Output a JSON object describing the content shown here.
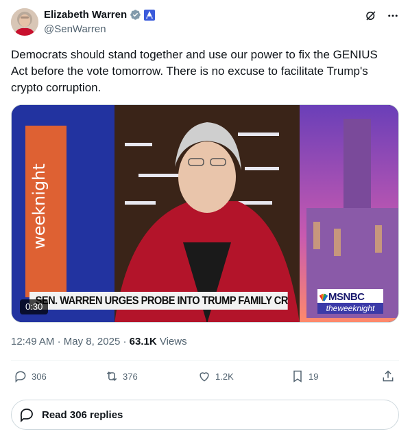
{
  "author": {
    "name": "Elizabeth Warren",
    "handle": "@SenWarren"
  },
  "tweet": {
    "text": "Democrats should stand together and use our power to fix the GENIUS Act before the vote tomorrow. There is no excuse to facilitate Trump's crypto corruption."
  },
  "media": {
    "chyron": "SEN. WARREN URGES PROBE INTO TRUMP FAMILY CRYPTO DEAL",
    "network": "MSNBC",
    "show": "weeknight",
    "show_prefix": "the",
    "duration": "0:30"
  },
  "meta": {
    "time": "12:49 AM",
    "date": "May 8, 2025",
    "views_count": "63.1K",
    "views_label": "Views",
    "separator": "·"
  },
  "actions": {
    "replies": "306",
    "reposts": "376",
    "likes": "1.2K",
    "bookmarks": "19"
  },
  "read_replies": "Read 306 replies",
  "colors": {
    "verified": "#1d9bf0",
    "text": "#0f1419",
    "secondary": "#536471"
  }
}
